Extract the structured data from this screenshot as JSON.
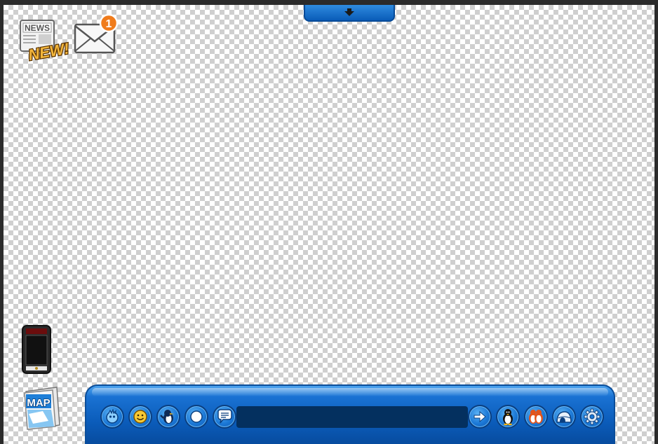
{
  "newspaper": {
    "icon": "newspaper-icon",
    "header_text": "NEWS",
    "badge_text": "NEW!"
  },
  "mail": {
    "icon": "envelope-icon",
    "unread_count": "1"
  },
  "phone": {
    "icon": "epf-phone-icon"
  },
  "map": {
    "icon": "map-icon",
    "label": "MAP"
  },
  "top_tab": {
    "icon": "down-arrow-icon"
  },
  "toolbar": {
    "left_buttons": [
      "puffle-icon",
      "emote-icon",
      "action-penguin-icon",
      "snowball-icon",
      "chat-bubble-icon"
    ],
    "chat_input": {
      "value": "",
      "placeholder": ""
    },
    "right_buttons": [
      "send-arrow-icon",
      "player-card-icon",
      "buddy-list-icon",
      "igloo-icon",
      "settings-gear-icon"
    ]
  },
  "colors": {
    "toolbar_blue": "#0b5cba",
    "chat_field": "#04305f",
    "badge_orange": "#f07c1c",
    "new_gold": "#f3b63c"
  }
}
